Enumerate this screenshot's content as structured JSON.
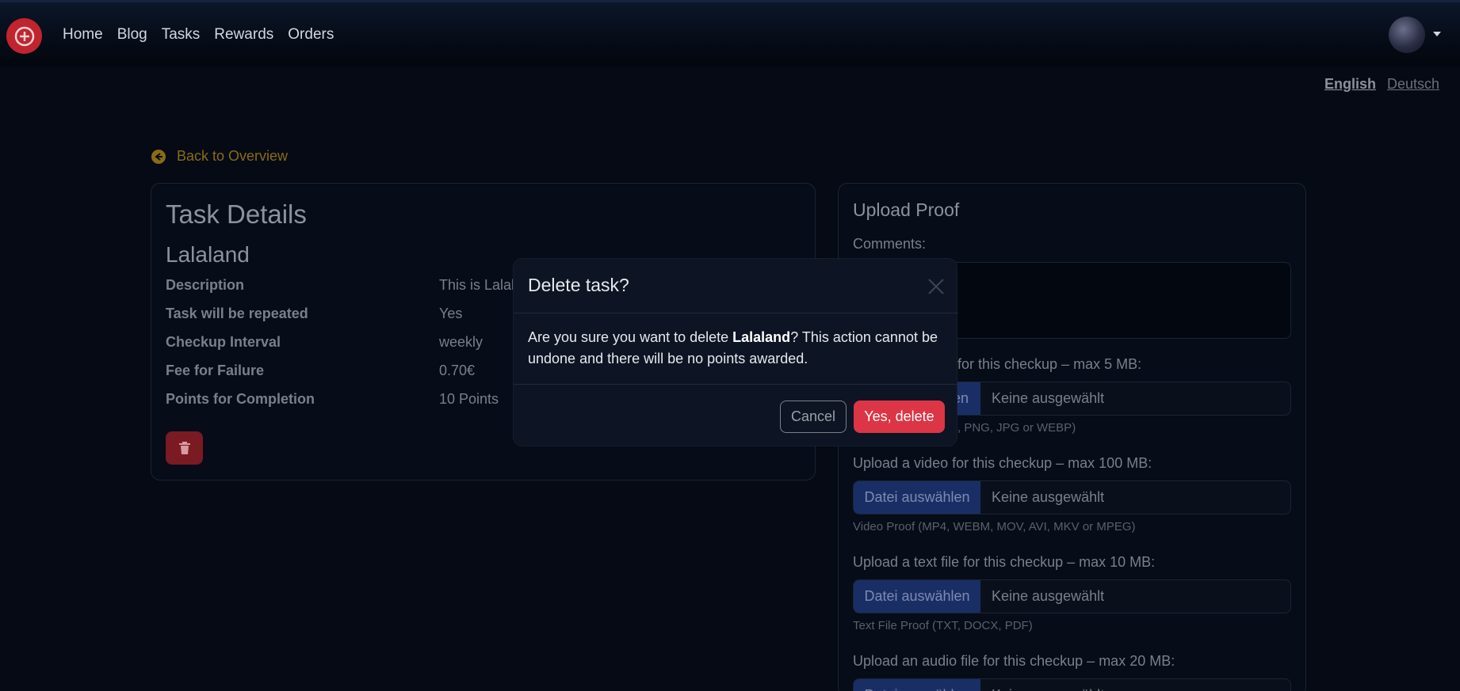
{
  "nav": {
    "links": [
      "Home",
      "Blog",
      "Tasks",
      "Rewards",
      "Orders"
    ]
  },
  "lang": {
    "english": "English",
    "deutsch": "Deutsch"
  },
  "back_label": "Back to Overview",
  "task": {
    "heading": "Task Details",
    "name": "Lalaland",
    "rows": [
      {
        "label": "Description",
        "value": "This is Lalal"
      },
      {
        "label": "Task will be repeated",
        "value": "Yes"
      },
      {
        "label": "Checkup Interval",
        "value": "weekly"
      },
      {
        "label": "Fee for Failure",
        "value": "0.70€"
      },
      {
        "label": "Points for Completion",
        "value": "10 Points"
      }
    ]
  },
  "upload": {
    "heading": "Upload Proof",
    "comments_label": "Comments:",
    "image_label": "for this checkup – max 5 MB:",
    "image_btn": "en",
    "image_status": "Keine ausgewählt",
    "image_hint": ", PNG, JPG or WEBP)",
    "video_label": "Upload a video for this checkup – max 100 MB:",
    "video_btn": "Datei auswählen",
    "video_status": "Keine ausgewählt",
    "video_hint": "Video Proof (MP4, WEBM, MOV, AVI, MKV or MPEG)",
    "text_label": "Upload a text file for this checkup – max 10 MB:",
    "text_btn": "Datei auswählen",
    "text_status": "Keine ausgewählt",
    "text_hint": "Text File Proof (TXT, DOCX, PDF)",
    "audio_label": "Upload an audio file for this checkup – max 20 MB:",
    "audio_btn": "Datei auswählen",
    "audio_status": "Keine ausgewählt"
  },
  "modal": {
    "title": "Delete task?",
    "body_prefix": "Are you sure you want to delete ",
    "body_name": "Lalaland",
    "body_suffix": "? This action cannot be undone and there will be no points awarded.",
    "cancel": "Cancel",
    "confirm": "Yes, delete"
  }
}
